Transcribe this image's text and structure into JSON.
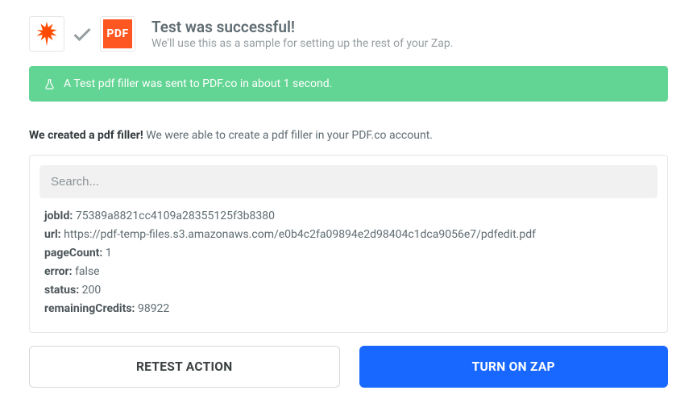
{
  "header": {
    "zapier_icon_name": "zapier-starburst",
    "pdf_badge_text": "PDF",
    "title": "Test was successful!",
    "subtitle": "We'll use this as a sample for setting up the rest of your Zap."
  },
  "banner": {
    "text": "A Test pdf filler was sent to PDF.co in about 1 second."
  },
  "intro": {
    "bold": "We created a pdf filler!",
    "rest": "We were able to create a pdf filler in your PDF.co account."
  },
  "search": {
    "placeholder": "Search..."
  },
  "result": [
    {
      "key": "jobId:",
      "value": "75389a8821cc4109a28355125f3b8380"
    },
    {
      "key": "url:",
      "value": "https://pdf-temp-files.s3.amazonaws.com/e0b4c2fa09894e2d98404c1dca9056e7/pdfedit.pdf"
    },
    {
      "key": "pageCount:",
      "value": "1"
    },
    {
      "key": "error:",
      "value": "false"
    },
    {
      "key": "status:",
      "value": "200"
    },
    {
      "key": "remainingCredits:",
      "value": "98922"
    }
  ],
  "buttons": {
    "retest": "RETEST ACTION",
    "turn_on": "TURN ON ZAP"
  }
}
